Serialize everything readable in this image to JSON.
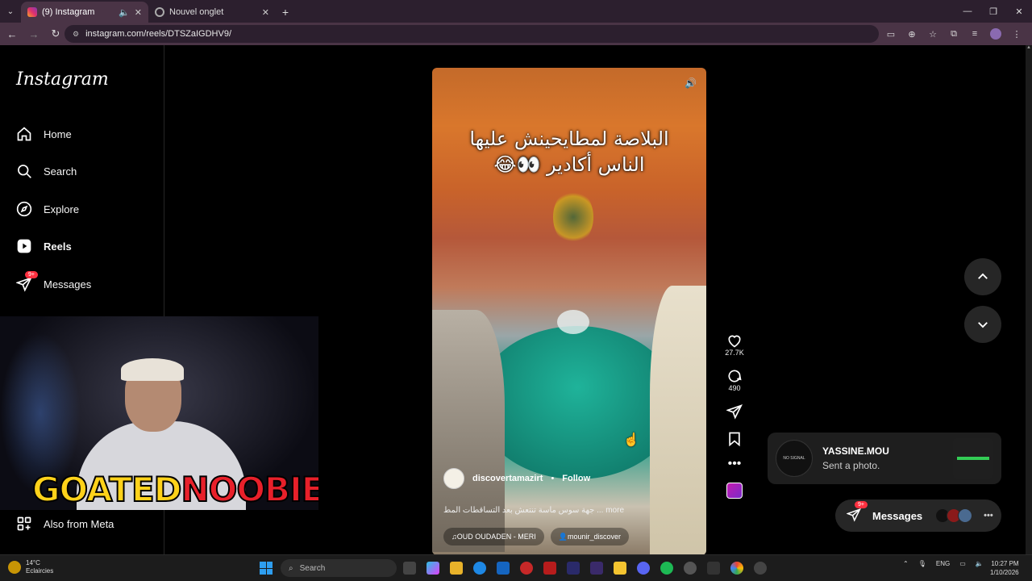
{
  "browser": {
    "tabs": [
      {
        "title": "(9) Instagram",
        "active": true
      },
      {
        "title": "Nouvel onglet",
        "active": false
      }
    ],
    "url": "instagram.com/reels/DTSZaIGDHV9/"
  },
  "sidebar": {
    "logo": "Instagram",
    "items": [
      {
        "label": "Home",
        "icon": "home-icon"
      },
      {
        "label": "Search",
        "icon": "search-icon"
      },
      {
        "label": "Explore",
        "icon": "compass-icon"
      },
      {
        "label": "Reels",
        "icon": "reels-icon"
      },
      {
        "label": "Messages",
        "icon": "messenger-icon",
        "badge": "9+"
      }
    ],
    "also_from_meta": "Also from Meta"
  },
  "webcam": {
    "overlay_left": "GOATED",
    "overlay_right": "NOOBIE"
  },
  "reel": {
    "caption_line1": "البلاصة لمطايحينش عليها",
    "caption_line2": "الناس أكادير 👀😂",
    "username": "discovertamazirt",
    "follow_label": "Follow",
    "description": "جهة سوس ماسة تنتعش بعد التساقطات المط ... more",
    "audio": "OUD OUDADEN - MERI",
    "tagged_user": "mounir_discover"
  },
  "actions": {
    "likes": "27.7K",
    "comments": "490"
  },
  "notification": {
    "name": "YASSINE.MOU",
    "message": "Sent a photo.",
    "avatar_text": "NO SIGNAL"
  },
  "messages_pill": {
    "label": "Messages",
    "badge": "9+"
  },
  "taskbar": {
    "temperature": "14°C",
    "weather": "Eclaircies",
    "search_placeholder": "Search",
    "language": "ENG",
    "time": "10:27 PM",
    "date": "1/10/2026"
  },
  "colors": {
    "chrome_bg": "#2c1f2e",
    "chrome_toolbar": "#4a3446",
    "badge_red": "#ff3040",
    "page_bg": "#000000"
  }
}
